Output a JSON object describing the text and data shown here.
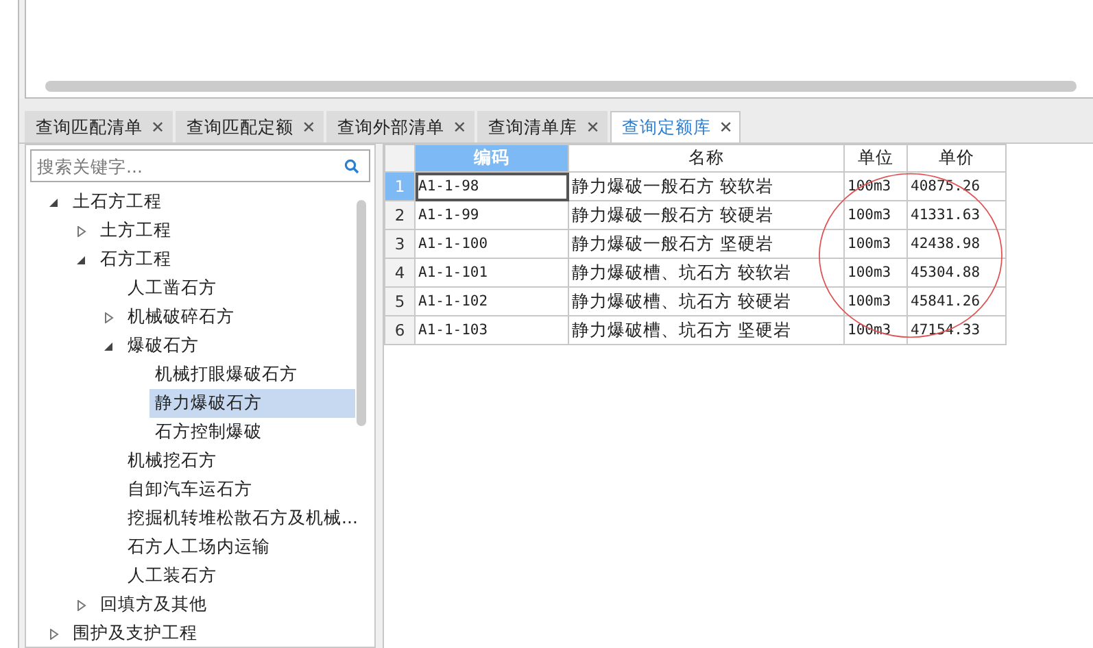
{
  "tabs": [
    {
      "label": "查询匹配清单",
      "close": "✕",
      "selected": false
    },
    {
      "label": "查询匹配定额",
      "close": "✕",
      "selected": false
    },
    {
      "label": "查询外部清单",
      "close": "✕",
      "selected": false
    },
    {
      "label": "查询清单库",
      "close": "✕",
      "selected": false
    },
    {
      "label": "查询定额库",
      "close": "✕",
      "selected": true
    }
  ],
  "search": {
    "placeholder": "搜索关键字..."
  },
  "tree": [
    {
      "label": "土石方工程",
      "expanded": true,
      "selected": false,
      "children": [
        {
          "label": "土方工程",
          "expanded": false,
          "selected": false
        },
        {
          "label": "石方工程",
          "expanded": true,
          "selected": false,
          "children": [
            {
              "label": "人工凿石方",
              "selected": false
            },
            {
              "label": "机械破碎石方",
              "expanded": false,
              "selected": false
            },
            {
              "label": "爆破石方",
              "expanded": true,
              "selected": false,
              "children": [
                {
                  "label": "机械打眼爆破石方",
                  "selected": false
                },
                {
                  "label": "静力爆破石方",
                  "selected": true
                },
                {
                  "label": "石方控制爆破",
                  "selected": false
                }
              ]
            },
            {
              "label": "机械挖石方",
              "selected": false
            },
            {
              "label": "自卸汽车运石方",
              "selected": false
            },
            {
              "label": "挖掘机转堆松散石方及机械...",
              "selected": false
            },
            {
              "label": "石方人工场内运输",
              "selected": false
            },
            {
              "label": "人工装石方",
              "selected": false
            }
          ]
        },
        {
          "label": "回填方及其他",
          "expanded": false,
          "selected": false
        }
      ]
    },
    {
      "label": "围护及支护工程",
      "expanded": false,
      "selected": false
    }
  ],
  "table": {
    "columns": [
      {
        "label": "编码",
        "selected": true
      },
      {
        "label": "名称",
        "selected": false
      },
      {
        "label": "单位",
        "selected": false
      },
      {
        "label": "单价",
        "selected": false
      }
    ],
    "rows": [
      {
        "index": "1",
        "selected": true,
        "cells": [
          "A1-1-98",
          "静力爆破一般石方 较软岩",
          "100m3",
          "40875.26"
        ]
      },
      {
        "index": "2",
        "selected": false,
        "cells": [
          "A1-1-99",
          "静力爆破一般石方 较硬岩",
          "100m3",
          "41331.63"
        ]
      },
      {
        "index": "3",
        "selected": false,
        "cells": [
          "A1-1-100",
          "静力爆破一般石方 坚硬岩",
          "100m3",
          "42438.98"
        ]
      },
      {
        "index": "4",
        "selected": false,
        "cells": [
          "A1-1-101",
          "静力爆破槽、坑石方 较软岩",
          "100m3",
          "45304.88"
        ]
      },
      {
        "index": "5",
        "selected": false,
        "cells": [
          "A1-1-102",
          "静力爆破槽、坑石方 较硬岩",
          "100m3",
          "45841.26"
        ]
      },
      {
        "index": "6",
        "selected": false,
        "cells": [
          "A1-1-103",
          "静力爆破槽、坑石方 坚硬岩",
          "100m3",
          "47154.33"
        ]
      }
    ]
  }
}
